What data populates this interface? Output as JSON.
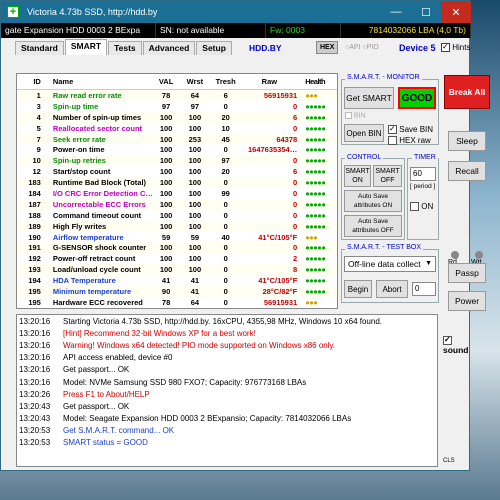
{
  "window": {
    "title": "Victoria 4.73b SSD, http://hdd.by",
    "minimize": "—",
    "maximize": "☐",
    "close": "✕"
  },
  "infobar": {
    "model": "gate Expansion HDD   0003 2 BExpa",
    "sn": "SN: not available",
    "fw": "Fw: 0003",
    "lba": "7814032066 LBA (4,0 Tb)"
  },
  "tabs": [
    "Standard",
    "SMART",
    "Tests",
    "Advanced",
    "Setup"
  ],
  "tabbar": {
    "site": "HDD.BY",
    "hex": "HEX",
    "api": "API",
    "pio": "PIO",
    "device": "Device 5",
    "hints": "Hints"
  },
  "smart_table": {
    "headers": {
      "id": "ID",
      "name": "Name",
      "val": "VAL",
      "wrst": "Wrst",
      "tresh": "Tresh",
      "raw": "Raw",
      "health": "Health"
    },
    "rows": [
      {
        "id": "1",
        "name": "Raw read error rate",
        "val": "78",
        "wrst": "64",
        "tresh": "6",
        "raw": "56915931",
        "health": "●●●",
        "color": "#0a8a0a"
      },
      {
        "id": "3",
        "name": "Spin-up time",
        "val": "97",
        "wrst": "97",
        "tresh": "0",
        "raw": "0",
        "health": "●●●●●",
        "color": "#0a8a0a"
      },
      {
        "id": "4",
        "name": "Number of spin-up times",
        "val": "100",
        "wrst": "100",
        "tresh": "20",
        "raw": "6",
        "health": "●●●●●",
        "color": "#000000"
      },
      {
        "id": "5",
        "name": "Reallocated sector count",
        "val": "100",
        "wrst": "100",
        "tresh": "10",
        "raw": "0",
        "health": "●●●●●",
        "color": "#c000c0"
      },
      {
        "id": "7",
        "name": "Seek error rate",
        "val": "100",
        "wrst": "253",
        "tresh": "45",
        "raw": "64378",
        "health": "●●●●●",
        "color": "#0a8a0a"
      },
      {
        "id": "9",
        "name": "Power-on time",
        "val": "100",
        "wrst": "100",
        "tresh": "0",
        "raw": "1647635354…",
        "health": "●●●●●",
        "color": "#000000"
      },
      {
        "id": "10",
        "name": "Spin-up retries",
        "val": "100",
        "wrst": "100",
        "tresh": "97",
        "raw": "0",
        "health": "●●●●●",
        "color": "#0a8a0a"
      },
      {
        "id": "12",
        "name": "Start/stop count",
        "val": "100",
        "wrst": "100",
        "tresh": "20",
        "raw": "6",
        "health": "●●●●●",
        "color": "#000000"
      },
      {
        "id": "183",
        "name": "Runtime Bad Block (Total)",
        "val": "100",
        "wrst": "100",
        "tresh": "0",
        "raw": "0",
        "health": "●●●●●",
        "color": "#000000"
      },
      {
        "id": "184",
        "name": "I/O CRC Error Detection C…",
        "val": "100",
        "wrst": "100",
        "tresh": "99",
        "raw": "0",
        "health": "●●●●●",
        "color": "#c000c0"
      },
      {
        "id": "187",
        "name": "Uncorrectable ECC Errors",
        "val": "100",
        "wrst": "100",
        "tresh": "0",
        "raw": "0",
        "health": "●●●●●",
        "color": "#c000c0"
      },
      {
        "id": "188",
        "name": "Command timeout count",
        "val": "100",
        "wrst": "100",
        "tresh": "0",
        "raw": "0",
        "health": "●●●●●",
        "color": "#000000"
      },
      {
        "id": "189",
        "name": "High Fly writes",
        "val": "100",
        "wrst": "100",
        "tresh": "0",
        "raw": "0",
        "health": "●●●●●",
        "color": "#000000"
      },
      {
        "id": "190",
        "name": "Airflow temperature",
        "val": "59",
        "wrst": "59",
        "tresh": "40",
        "raw": "41°C/105°F",
        "health": "●●●",
        "color": "#1a3fd0"
      },
      {
        "id": "191",
        "name": "G-SENSOR shock counter",
        "val": "100",
        "wrst": "100",
        "tresh": "0",
        "raw": "0",
        "health": "●●●●●",
        "color": "#000000"
      },
      {
        "id": "192",
        "name": "Power-off retract count",
        "val": "100",
        "wrst": "100",
        "tresh": "0",
        "raw": "2",
        "health": "●●●●●",
        "color": "#000000"
      },
      {
        "id": "193",
        "name": "Load/unload cycle count",
        "val": "100",
        "wrst": "100",
        "tresh": "0",
        "raw": "8",
        "health": "●●●●●",
        "color": "#000000"
      },
      {
        "id": "194",
        "name": "HDA Temperature",
        "val": "41",
        "wrst": "41",
        "tresh": "0",
        "raw": "41°C/105°F",
        "health": "●●●●●",
        "color": "#1a3fd0"
      },
      {
        "id": "195",
        "name": "Minimum temperature",
        "val": "90",
        "wrst": "41",
        "tresh": "0",
        "raw": "28°C/82°F",
        "health": "●●●●●",
        "color": "#1a3fd0"
      },
      {
        "id": "195",
        "name": "Hardware ECC recovered",
        "val": "78",
        "wrst": "64",
        "tresh": "0",
        "raw": "56915931",
        "health": "●●●",
        "color": "#000000"
      }
    ]
  },
  "smart_monitor": {
    "title": "S.M.A.R.T. - MONITOR",
    "get_smart": "Get SMART",
    "status": "GOOD",
    "bin_label": "BIN",
    "open_bin": "Open BIN",
    "save_bin": "Save BIN",
    "hex_raw": "HEX raw"
  },
  "control": {
    "title": "CONTROL",
    "smart_on": "SMART ON",
    "smart_off": "SMART OFF",
    "autosave_on": "Auto Save attributes ON",
    "autosave_off": "Auto Save attributes OFF"
  },
  "timer": {
    "title": "TIMER",
    "value": "60",
    "period": "[ period ]",
    "on": "ON"
  },
  "testbox": {
    "title": "S.M.A.R.T. - TEST BOX",
    "select": "Off-line data collect",
    "begin": "Begin",
    "abort": "Abort",
    "value": "0"
  },
  "right": {
    "break": "Break All",
    "sleep": "Sleep",
    "recall": "Recall",
    "rd": "Rd",
    "wrt": "Wrt",
    "passp": "Passp",
    "power": "Power",
    "sound": "sound",
    "cls": "CLS"
  },
  "log": [
    {
      "time": "13:20:16",
      "text": "Starting Victoria 4.73b SSD, http://hdd.by. 16xCPU, 4355,98 MHz, Windows 10 x64 found.",
      "color": "#000000"
    },
    {
      "time": "13:20:16",
      "text": "[Hint] Recommend 32-bit Windows XP for a best work!",
      "color": "#d00000"
    },
    {
      "time": "13:20:16",
      "text": "Warning! Windows x64 detected! PIO mode supported on Windows x86 only.",
      "color": "#d00000"
    },
    {
      "time": "13:20:16",
      "text": "API access enabled, device #0",
      "color": "#000000"
    },
    {
      "time": "13:20:16",
      "text": "Get passport... OK",
      "color": "#000000"
    },
    {
      "time": "13:20:16",
      "text": "Model: NVMe    Samsung SSD 980 FXO7; Capacity: 976773168 LBAs",
      "color": "#000000"
    },
    {
      "time": "13:20:26",
      "text": "Press F1 to About/HELP",
      "color": "#d00000"
    },
    {
      "time": "13:20:43",
      "text": "Get passport... OK",
      "color": "#000000"
    },
    {
      "time": "13:20:43",
      "text": "Model: Seagate Expansion HDD    0003 2 BExpansio; Capacity: 7814032066 LBAs",
      "color": "#000000"
    },
    {
      "time": "13:20:53",
      "text": "Get S.M.A.R.T. command... OK",
      "color": "#1a3fd0"
    },
    {
      "time": "13:20:53",
      "text": "SMART status = GOOD",
      "color": "#1a3fd0"
    }
  ]
}
